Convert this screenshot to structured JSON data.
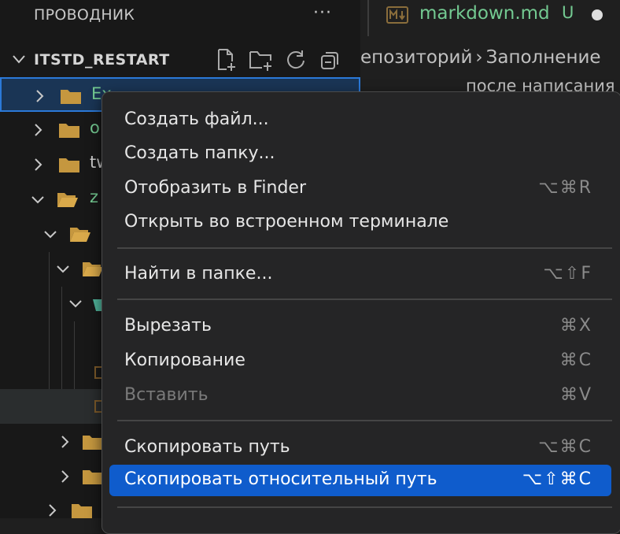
{
  "sidebar": {
    "title": "ПРОВОДНИК",
    "more": "···",
    "project": {
      "name": "ITSTD_RESTART",
      "actions": [
        {
          "icon": "new-file-icon"
        },
        {
          "icon": "new-folder-icon"
        },
        {
          "icon": "refresh-icon"
        },
        {
          "icon": "collapse-all-icon"
        }
      ]
    },
    "tree": [
      {
        "label": "Ex",
        "color": "#73c991",
        "expanded": false,
        "selected": true
      },
      {
        "label": "o",
        "color": "#73c991",
        "expanded": false
      },
      {
        "label": "tw",
        "color": "#cccccc",
        "expanded": false
      },
      {
        "label": "z",
        "color": "#73c991",
        "expanded": true
      }
    ]
  },
  "tab": {
    "name": "markdown.md",
    "status": "U",
    "icon": "markdown-icon"
  },
  "breadcrumb": {
    "items": [
      "епозиторий",
      "Заполнение"
    ]
  },
  "editor": {
    "text": "после написания"
  },
  "menu": {
    "groups": [
      [
        {
          "label": "Создать файл...",
          "shortcut": ""
        },
        {
          "label": "Создать папку...",
          "shortcut": ""
        },
        {
          "label": "Отобразить в Finder",
          "shortcut": "⌥⌘R"
        },
        {
          "label": "Открыть во встроенном терминале",
          "shortcut": ""
        }
      ],
      [
        {
          "label": "Найти в папке...",
          "shortcut": "⌥⇧F"
        }
      ],
      [
        {
          "label": "Вырезать",
          "shortcut": "⌘X"
        },
        {
          "label": "Копирование",
          "shortcut": "⌘C"
        },
        {
          "label": "Вставить",
          "shortcut": "⌘V",
          "disabled": true
        }
      ],
      [
        {
          "label": "Скопировать путь",
          "shortcut": "⌥⌘C"
        },
        {
          "label": "Скопировать относительный путь",
          "shortcut": "⌥⇧⌘C",
          "active": true
        }
      ]
    ]
  },
  "colors": {
    "accent": "#0f5ccc",
    "selection_border": "#2b79d8",
    "git_untracked": "#73c991",
    "folder": "#c5973f"
  }
}
